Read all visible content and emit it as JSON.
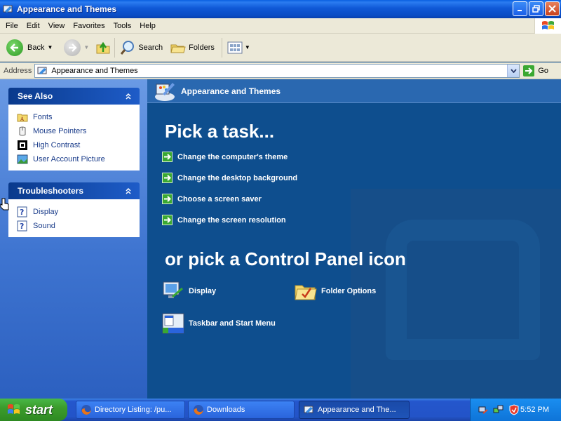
{
  "window": {
    "title": "Appearance and Themes"
  },
  "menu": [
    "File",
    "Edit",
    "View",
    "Favorites",
    "Tools",
    "Help"
  ],
  "toolbar": {
    "back_label": "Back",
    "search_label": "Search",
    "folders_label": "Folders"
  },
  "address": {
    "label": "Address",
    "value": "Appearance and Themes",
    "go_label": "Go"
  },
  "see_also": {
    "title": "See Also",
    "items": [
      {
        "label": "Fonts",
        "icon": "fonts-folder-icon"
      },
      {
        "label": "Mouse Pointers",
        "icon": "mouse-icon"
      },
      {
        "label": "High Contrast",
        "icon": "high-contrast-icon"
      },
      {
        "label": "User Account Picture",
        "icon": "user-picture-icon"
      }
    ]
  },
  "troubleshooters": {
    "title": "Troubleshooters",
    "items": [
      {
        "label": "Display",
        "icon": "help-icon"
      },
      {
        "label": "Sound",
        "icon": "help-icon"
      }
    ]
  },
  "main": {
    "header_title": "Appearance and Themes",
    "pick_task": "Pick a task...",
    "tasks": [
      "Change the computer's theme",
      "Change the desktop background",
      "Choose a screen saver",
      "Change the screen resolution"
    ],
    "pick_icon": "or pick a Control Panel icon",
    "icons": [
      {
        "label": "Display",
        "icon": "display-icon"
      },
      {
        "label": "Folder Options",
        "icon": "folder-options-icon"
      },
      {
        "label": "Taskbar and Start Menu",
        "icon": "taskbar-icon"
      }
    ]
  },
  "taskbar": {
    "start_label": "start",
    "buttons": [
      {
        "label": "Directory Listing: /pu...",
        "icon": "firefox-icon"
      },
      {
        "label": "Downloads",
        "icon": "firefox-icon"
      },
      {
        "label": "Appearance and The...",
        "icon": "appearance-icon"
      }
    ],
    "clock": "5:52 PM"
  },
  "colors": {
    "xp_blue": "#0a4cc4",
    "main_bg": "#0e4e8e",
    "start_green": "#3c9c2c"
  }
}
